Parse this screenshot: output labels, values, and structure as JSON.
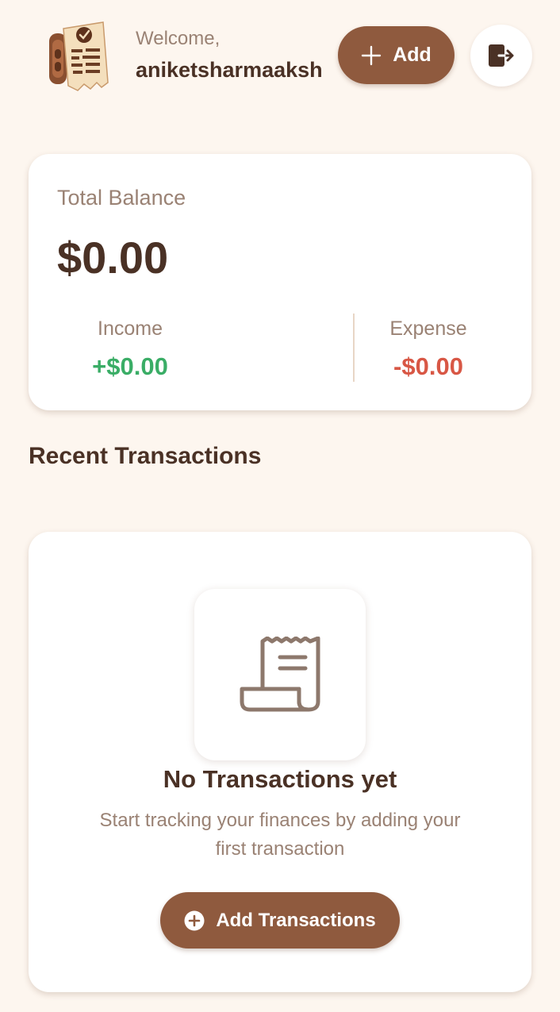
{
  "header": {
    "welcome_label": "Welcome,",
    "username": "aniketsharmaaksh",
    "add_label": "Add"
  },
  "balance": {
    "label": "Total Balance",
    "value": "$0.00",
    "income_label": "Income",
    "income_value": "+$0.00",
    "expense_label": "Expense",
    "expense_value": "-$0.00"
  },
  "recent": {
    "title": "Recent Transactions",
    "empty_title": "No Transactions yet",
    "empty_description": "Start tracking your finances by adding your first transaction",
    "add_button_label": "Add Transactions"
  },
  "icons": {
    "logo": "receipt-logo-icon",
    "add": "plus-icon",
    "logout": "logout-icon",
    "empty": "receipt-icon",
    "add_transaction": "plus-circle-icon"
  },
  "colors": {
    "background": "#fdf6ef",
    "accent": "#8f5a3e",
    "income": "#3aad66",
    "expense": "#d85745",
    "text_primary": "#4a3125",
    "text_secondary": "#9a8274"
  }
}
